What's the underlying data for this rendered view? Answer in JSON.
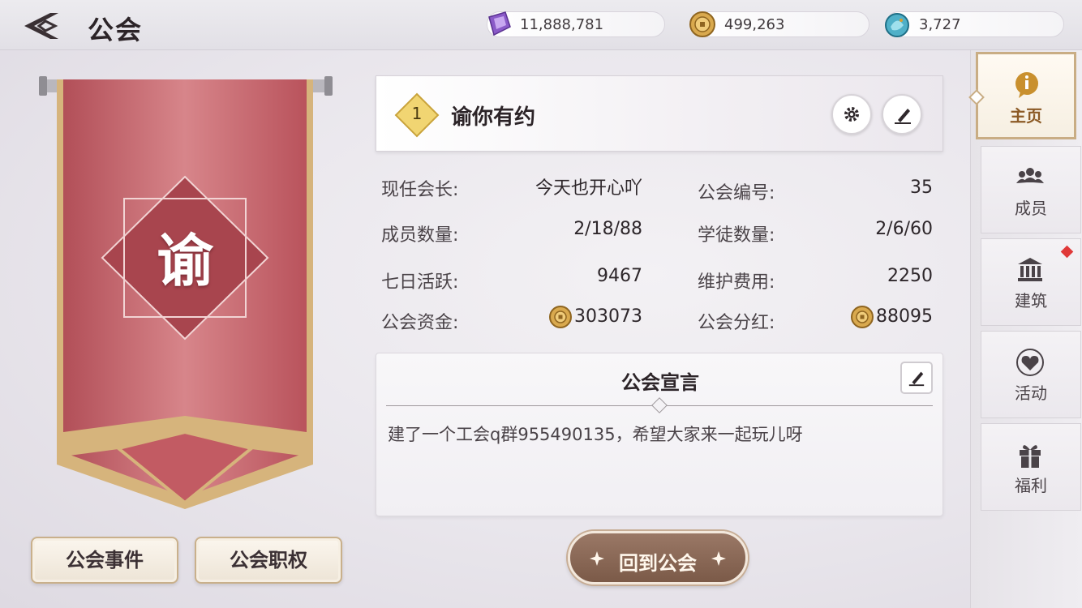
{
  "header": {
    "title": "公会",
    "currencies": [
      {
        "name": "purple-crystal",
        "value": "11,888,781"
      },
      {
        "name": "gold-coin",
        "value": "499,263"
      },
      {
        "name": "dragon-token",
        "value": "3,727"
      }
    ]
  },
  "banner": {
    "emblem_char": "谕",
    "color": "#c7666c"
  },
  "guild": {
    "level": "1",
    "name": "谕你有约"
  },
  "info": {
    "leader_label": "现任会长:",
    "leader_value": "今天也开心吖",
    "id_label": "公会编号:",
    "id_value": "35",
    "members_label": "成员数量:",
    "members_value": "2/18/88",
    "apprentices_label": "学徒数量:",
    "apprentices_value": "2/6/60",
    "activity_label": "七日活跃:",
    "activity_value": "9467",
    "upkeep_label": "维护费用:",
    "upkeep_value": "2250",
    "funds_label": "公会资金:",
    "funds_value": "303073",
    "dividend_label": "公会分红:",
    "dividend_value": "88095"
  },
  "declaration": {
    "title": "公会宣言",
    "text": "建了一个工会q群955490135，希望大家来一起玩儿呀"
  },
  "buttons": {
    "events": "公会事件",
    "roles": "公会职权",
    "return": "回到公会"
  },
  "nav": {
    "items": [
      {
        "label": "主页",
        "icon": "info-icon",
        "active": true
      },
      {
        "label": "成员",
        "icon": "members-icon",
        "active": false
      },
      {
        "label": "建筑",
        "icon": "building-icon",
        "active": false,
        "badge": true
      },
      {
        "label": "活动",
        "icon": "hearts-icon",
        "active": false
      },
      {
        "label": "福利",
        "icon": "gift-icon",
        "active": false
      }
    ]
  },
  "colors": {
    "accent_gold": "#c9ad84",
    "button_brown": "#8a6856",
    "badge_red": "#e03838"
  }
}
